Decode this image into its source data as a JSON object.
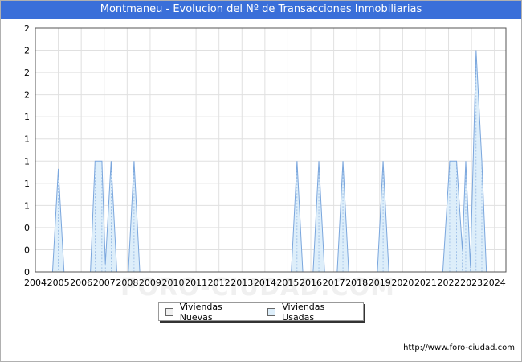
{
  "header": {
    "title": "Montmaneu - Evolucion del Nº de Transacciones Inmobiliarias"
  },
  "footer": {
    "url": "http://www.foro-ciudad.com"
  },
  "watermark": {
    "text": "FORO-CIUDAD.COM"
  },
  "colors": {
    "title_bg": "#3a6fd9",
    "usadas_fill": "#ddeefa",
    "usadas_line": "#7aa6dd",
    "nuevas_fill": "#f0f0f0"
  },
  "chart_data": {
    "type": "area",
    "title": "Montmaneu - Evolucion del Nº de Transacciones Inmobiliarias",
    "xlabel": "",
    "ylabel": "",
    "xlim": [
      2004,
      2024.5
    ],
    "ylim": [
      0,
      2.2
    ],
    "x_ticks": [
      "2004",
      "2005",
      "2006",
      "2007",
      "2008",
      "2009",
      "2010",
      "2011",
      "2012",
      "2013",
      "2014",
      "2015",
      "2016",
      "2017",
      "2018",
      "2019",
      "2020",
      "2021",
      "2022",
      "2023",
      "2024"
    ],
    "y_ticks": [
      {
        "v": 0,
        "label": "0"
      },
      {
        "v": 0.2,
        "label": "0"
      },
      {
        "v": 0.4,
        "label": "0"
      },
      {
        "v": 0.6,
        "label": "1"
      },
      {
        "v": 0.8,
        "label": "1"
      },
      {
        "v": 1.0,
        "label": "1"
      },
      {
        "v": 1.2,
        "label": "1"
      },
      {
        "v": 1.4,
        "label": "1"
      },
      {
        "v": 1.6,
        "label": "2"
      },
      {
        "v": 1.8,
        "label": "2"
      },
      {
        "v": 2.0,
        "label": "2"
      },
      {
        "v": 2.2,
        "label": "2"
      }
    ],
    "grid": true,
    "legend_position": "bottom-center",
    "series": [
      {
        "name": "Viviendas Nuevas",
        "points": []
      },
      {
        "name": "Viviendas Usadas",
        "points": [
          {
            "x": 2004.75,
            "y": 0
          },
          {
            "x": 2005.0,
            "y": 0.93
          },
          {
            "x": 2005.25,
            "y": 0
          },
          {
            "x": 2006.4,
            "y": 0
          },
          {
            "x": 2006.6,
            "y": 1
          },
          {
            "x": 2006.9,
            "y": 1
          },
          {
            "x": 2007.05,
            "y": 0.07
          },
          {
            "x": 2007.3,
            "y": 1
          },
          {
            "x": 2007.55,
            "y": 0
          },
          {
            "x": 2008.05,
            "y": 0
          },
          {
            "x": 2008.3,
            "y": 1
          },
          {
            "x": 2008.55,
            "y": 0
          },
          {
            "x": 2015.15,
            "y": 0
          },
          {
            "x": 2015.4,
            "y": 1
          },
          {
            "x": 2015.65,
            "y": 0
          },
          {
            "x": 2016.1,
            "y": 0
          },
          {
            "x": 2016.35,
            "y": 1
          },
          {
            "x": 2016.6,
            "y": 0
          },
          {
            "x": 2017.15,
            "y": 0
          },
          {
            "x": 2017.4,
            "y": 1
          },
          {
            "x": 2017.65,
            "y": 0
          },
          {
            "x": 2018.9,
            "y": 0
          },
          {
            "x": 2019.15,
            "y": 1
          },
          {
            "x": 2019.4,
            "y": 0
          },
          {
            "x": 2021.75,
            "y": 0
          },
          {
            "x": 2022.05,
            "y": 1
          },
          {
            "x": 2022.35,
            "y": 1
          },
          {
            "x": 2022.6,
            "y": 0.2
          },
          {
            "x": 2022.75,
            "y": 1
          },
          {
            "x": 2022.95,
            "y": 0.05
          },
          {
            "x": 2023.2,
            "y": 2
          },
          {
            "x": 2023.45,
            "y": 1
          },
          {
            "x": 2023.65,
            "y": 0
          }
        ]
      }
    ]
  }
}
